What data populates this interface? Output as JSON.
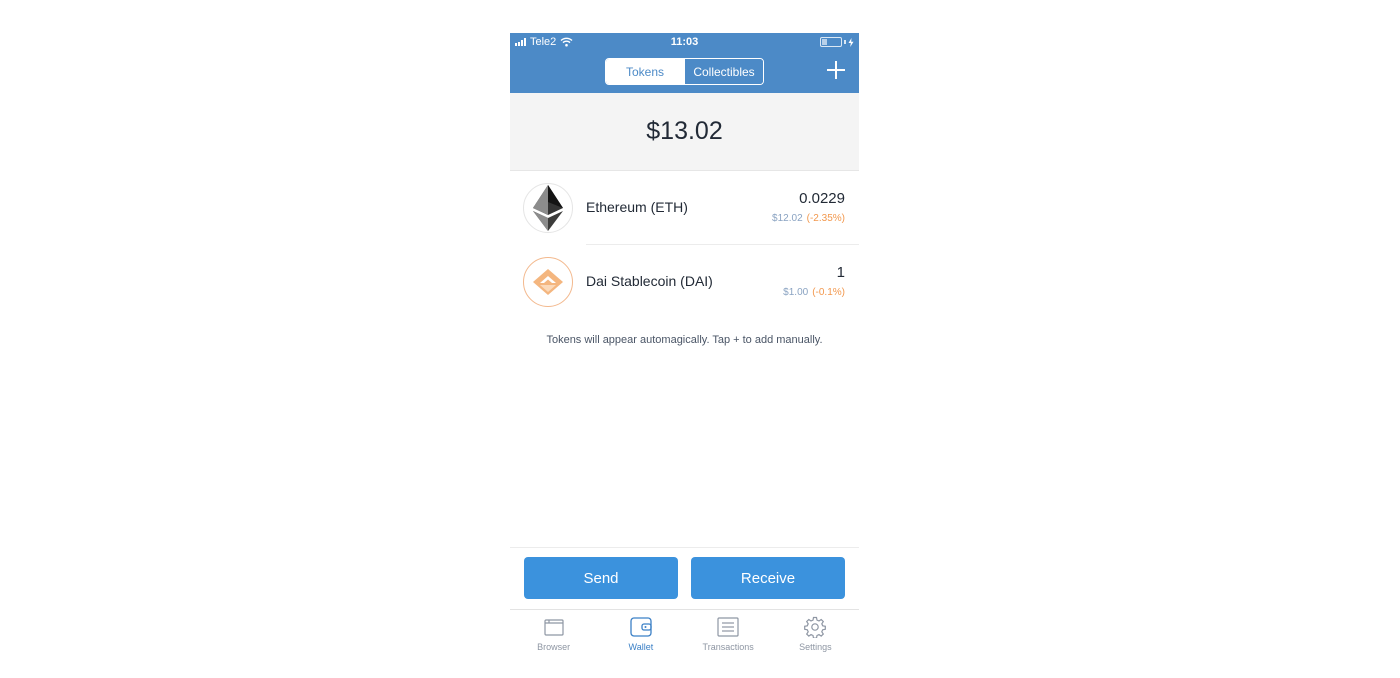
{
  "status_bar": {
    "carrier": "Tele2",
    "time": "11:03"
  },
  "nav": {
    "tabs": [
      {
        "label": "Tokens",
        "active": true
      },
      {
        "label": "Collectibles",
        "active": false
      }
    ],
    "add_icon": "plus-icon"
  },
  "wallet": {
    "total_balance": "$13.02"
  },
  "tokens": [
    {
      "name": "Ethereum (ETH)",
      "amount": "0.0229",
      "usd_value": "$12.02",
      "change": "(-2.35%)",
      "icon": "ethereum-icon"
    },
    {
      "name": "Dai Stablecoin (DAI)",
      "amount": "1",
      "usd_value": "$1.00",
      "change": "(-0.1%)",
      "icon": "dai-icon"
    }
  ],
  "hint_text": "Tokens will appear automagically. Tap + to add manually.",
  "actions": {
    "send_label": "Send",
    "receive_label": "Receive"
  },
  "tab_bar": {
    "items": [
      {
        "label": "Browser",
        "icon": "browser-icon",
        "active": false
      },
      {
        "label": "Wallet",
        "icon": "wallet-icon",
        "active": true
      },
      {
        "label": "Transactions",
        "icon": "transactions-icon",
        "active": false
      },
      {
        "label": "Settings",
        "icon": "settings-gear-icon",
        "active": false
      }
    ]
  },
  "colors": {
    "nav_blue": "#4c8ac7",
    "button_blue": "#3b92dd",
    "change_orange": "#f2984e",
    "active_tab": "#3b80c6"
  }
}
